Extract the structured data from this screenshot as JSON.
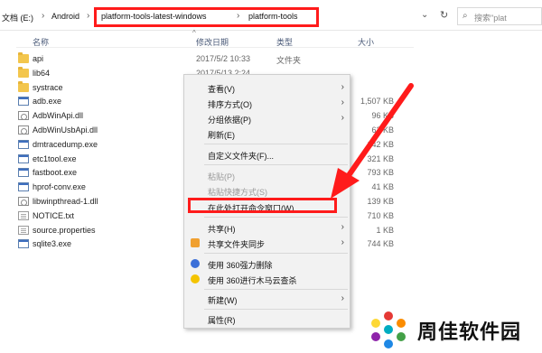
{
  "address": {
    "crumbs": [
      "文档 (E:)",
      "Android",
      "platform-tools-latest-windows",
      "platform-tools"
    ],
    "search_placeholder": "搜索\"plat"
  },
  "columns": {
    "name": "名称",
    "date": "修改日期",
    "type": "类型",
    "size": "大小"
  },
  "files": [
    {
      "name": "api",
      "icon": "folder-icon",
      "date": "2017/5/2 10:33",
      "type": "文件夹",
      "size": ""
    },
    {
      "name": "lib64",
      "icon": "folder-icon",
      "date": "2017/5/13 2:24",
      "type": "",
      "size": ""
    },
    {
      "name": "systrace",
      "icon": "folder-icon",
      "date": "",
      "type": "",
      "size": ""
    },
    {
      "name": "adb.exe",
      "icon": "exe-icon",
      "date": "",
      "type": "",
      "size": "1,507 KB"
    },
    {
      "name": "AdbWinApi.dll",
      "icon": "dll-icon",
      "date": "",
      "type": "",
      "size": "96 KB"
    },
    {
      "name": "AdbWinUsbApi.dll",
      "icon": "dll-icon",
      "date": "",
      "type": "",
      "size": "62 KB"
    },
    {
      "name": "dmtracedump.exe",
      "icon": "exe-icon",
      "date": "",
      "type": "",
      "size": "142 KB"
    },
    {
      "name": "etc1tool.exe",
      "icon": "exe-icon",
      "date": "",
      "type": "",
      "size": "321 KB"
    },
    {
      "name": "fastboot.exe",
      "icon": "exe-icon",
      "date": "",
      "type": "",
      "size": "793 KB"
    },
    {
      "name": "hprof-conv.exe",
      "icon": "exe-icon",
      "date": "",
      "type": "",
      "size": "41 KB"
    },
    {
      "name": "libwinpthread-1.dll",
      "icon": "dll-icon",
      "date": "",
      "type": "",
      "size": "139 KB"
    },
    {
      "name": "NOTICE.txt",
      "icon": "doc-icon",
      "date": "",
      "type": "",
      "size": "710 KB"
    },
    {
      "name": "source.properties",
      "icon": "doc-icon",
      "date": "",
      "type": "",
      "size": "1 KB"
    },
    {
      "name": "sqlite3.exe",
      "icon": "exe-icon",
      "date": "",
      "type": "",
      "size": "744 KB"
    }
  ],
  "menu": {
    "view": "查看(V)",
    "sort": "排序方式(O)",
    "group": "分组依据(P)",
    "refresh": "刷新(E)",
    "customize": "自定义文件夹(F)...",
    "paste": "粘贴(P)",
    "paste_shortcut": "粘贴快捷方式(S)",
    "open_cmd": "在此处打开命令窗口(W)",
    "share": "共享(H)",
    "shared_sync": "共享文件夹同步",
    "scan_delete": "使用 360强力删除",
    "trojan_scan": "使用 360进行木马云查杀",
    "new": "新建(W)",
    "properties": "属性(R)"
  },
  "colors": {
    "highlight_red": "#ff1b1b"
  },
  "watermark": {
    "text": "周佳软件园"
  }
}
